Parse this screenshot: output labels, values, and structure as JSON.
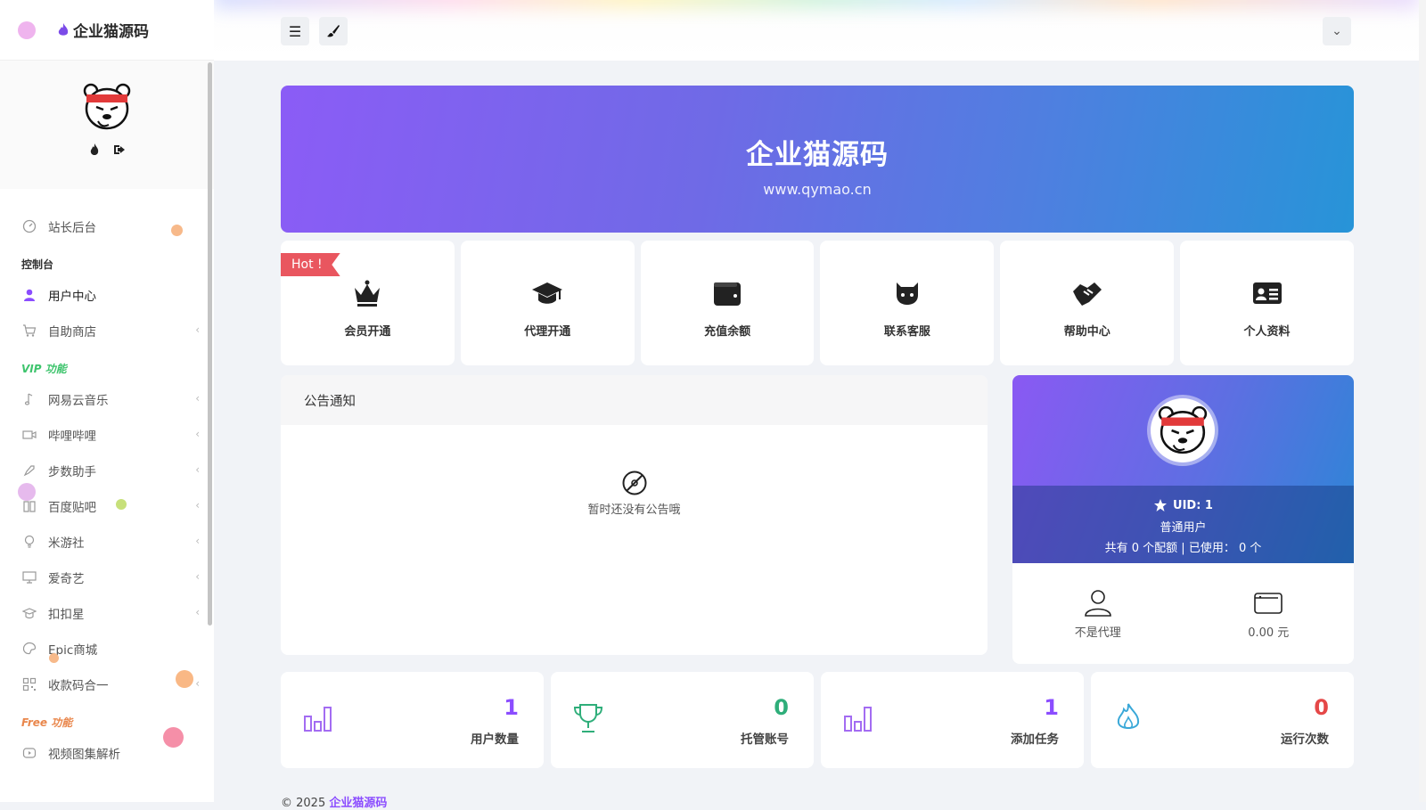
{
  "brand": {
    "name": "企业猫源码"
  },
  "sidebar": {
    "items": [
      {
        "key": "admin",
        "label": "站长后台",
        "icon": "dashboard-icon"
      },
      {
        "key": "console",
        "section": "控制台"
      },
      {
        "key": "user-center",
        "label": "用户中心",
        "icon": "user-icon",
        "active": true
      },
      {
        "key": "shop",
        "label": "自助商店",
        "icon": "cart-icon",
        "chevron": "‹"
      },
      {
        "key": "vip",
        "section": "VIP 功能"
      },
      {
        "key": "netease",
        "label": "网易云音乐",
        "icon": "music-note-icon",
        "chevron": "‹"
      },
      {
        "key": "bilibili",
        "label": "哔哩哔哩",
        "icon": "video-icon",
        "chevron": "‹"
      },
      {
        "key": "steps",
        "label": "步数助手",
        "icon": "rocket-icon",
        "chevron": "‹"
      },
      {
        "key": "tieba",
        "label": "百度贴吧",
        "icon": "book-icon",
        "chevron": "‹"
      },
      {
        "key": "miyoushe",
        "label": "米游社",
        "icon": "lightbulb-icon",
        "chevron": "‹"
      },
      {
        "key": "iqiyi",
        "label": "爱奇艺",
        "icon": "monitor-icon",
        "chevron": "‹"
      },
      {
        "key": "koukouxing",
        "label": "扣扣星",
        "icon": "graduation-cap-icon",
        "chevron": "‹"
      },
      {
        "key": "epic",
        "label": "Epic商城",
        "icon": "palette-icon"
      },
      {
        "key": "qrcode",
        "label": "收款码合一",
        "icon": "qr-icon",
        "chevron": "‹"
      },
      {
        "key": "free",
        "section": "Free 功能"
      },
      {
        "key": "video-parse",
        "label": "视频图集解析",
        "icon": "play-icon"
      }
    ]
  },
  "topbar": {
    "menu_icon": "☰",
    "collapse_icon": "⌄"
  },
  "banner": {
    "title": "企业猫源码",
    "subtitle": "www.qymao.cn"
  },
  "cards": [
    {
      "label": "会员开通",
      "icon": "crown-icon",
      "badge": "Hot !"
    },
    {
      "label": "代理开通",
      "icon": "graduation-cap-icon"
    },
    {
      "label": "充值余额",
      "icon": "wallet-icon"
    },
    {
      "label": "联系客服",
      "icon": "github-cat-icon"
    },
    {
      "label": "帮助中心",
      "icon": "handshake-icon"
    },
    {
      "label": "个人资料",
      "icon": "id-card-icon"
    }
  ],
  "notice": {
    "title": "公告通知",
    "empty": "暂时还没有公告哦"
  },
  "user": {
    "uid": "UID: 1",
    "role": "普通用户",
    "quota": "共有 0 个配额 | 已使用： 0 个",
    "agent": "不是代理",
    "balance": "0.00 元"
  },
  "stats": [
    {
      "value": "1",
      "label": "用户数量",
      "icon": "bar-chart-icon",
      "color": "#8b4dff"
    },
    {
      "value": "0",
      "label": "托管账号",
      "icon": "trophy-icon",
      "color": "#2fae7a"
    },
    {
      "value": "1",
      "label": "添加任务",
      "icon": "bar-chart-icon",
      "color": "#8b4dff"
    },
    {
      "value": "0",
      "label": "运行次数",
      "icon": "fire-icon",
      "color": "#e54848"
    }
  ],
  "footer": {
    "prefix": "© 2025 ",
    "brand": "企业猫源码"
  }
}
